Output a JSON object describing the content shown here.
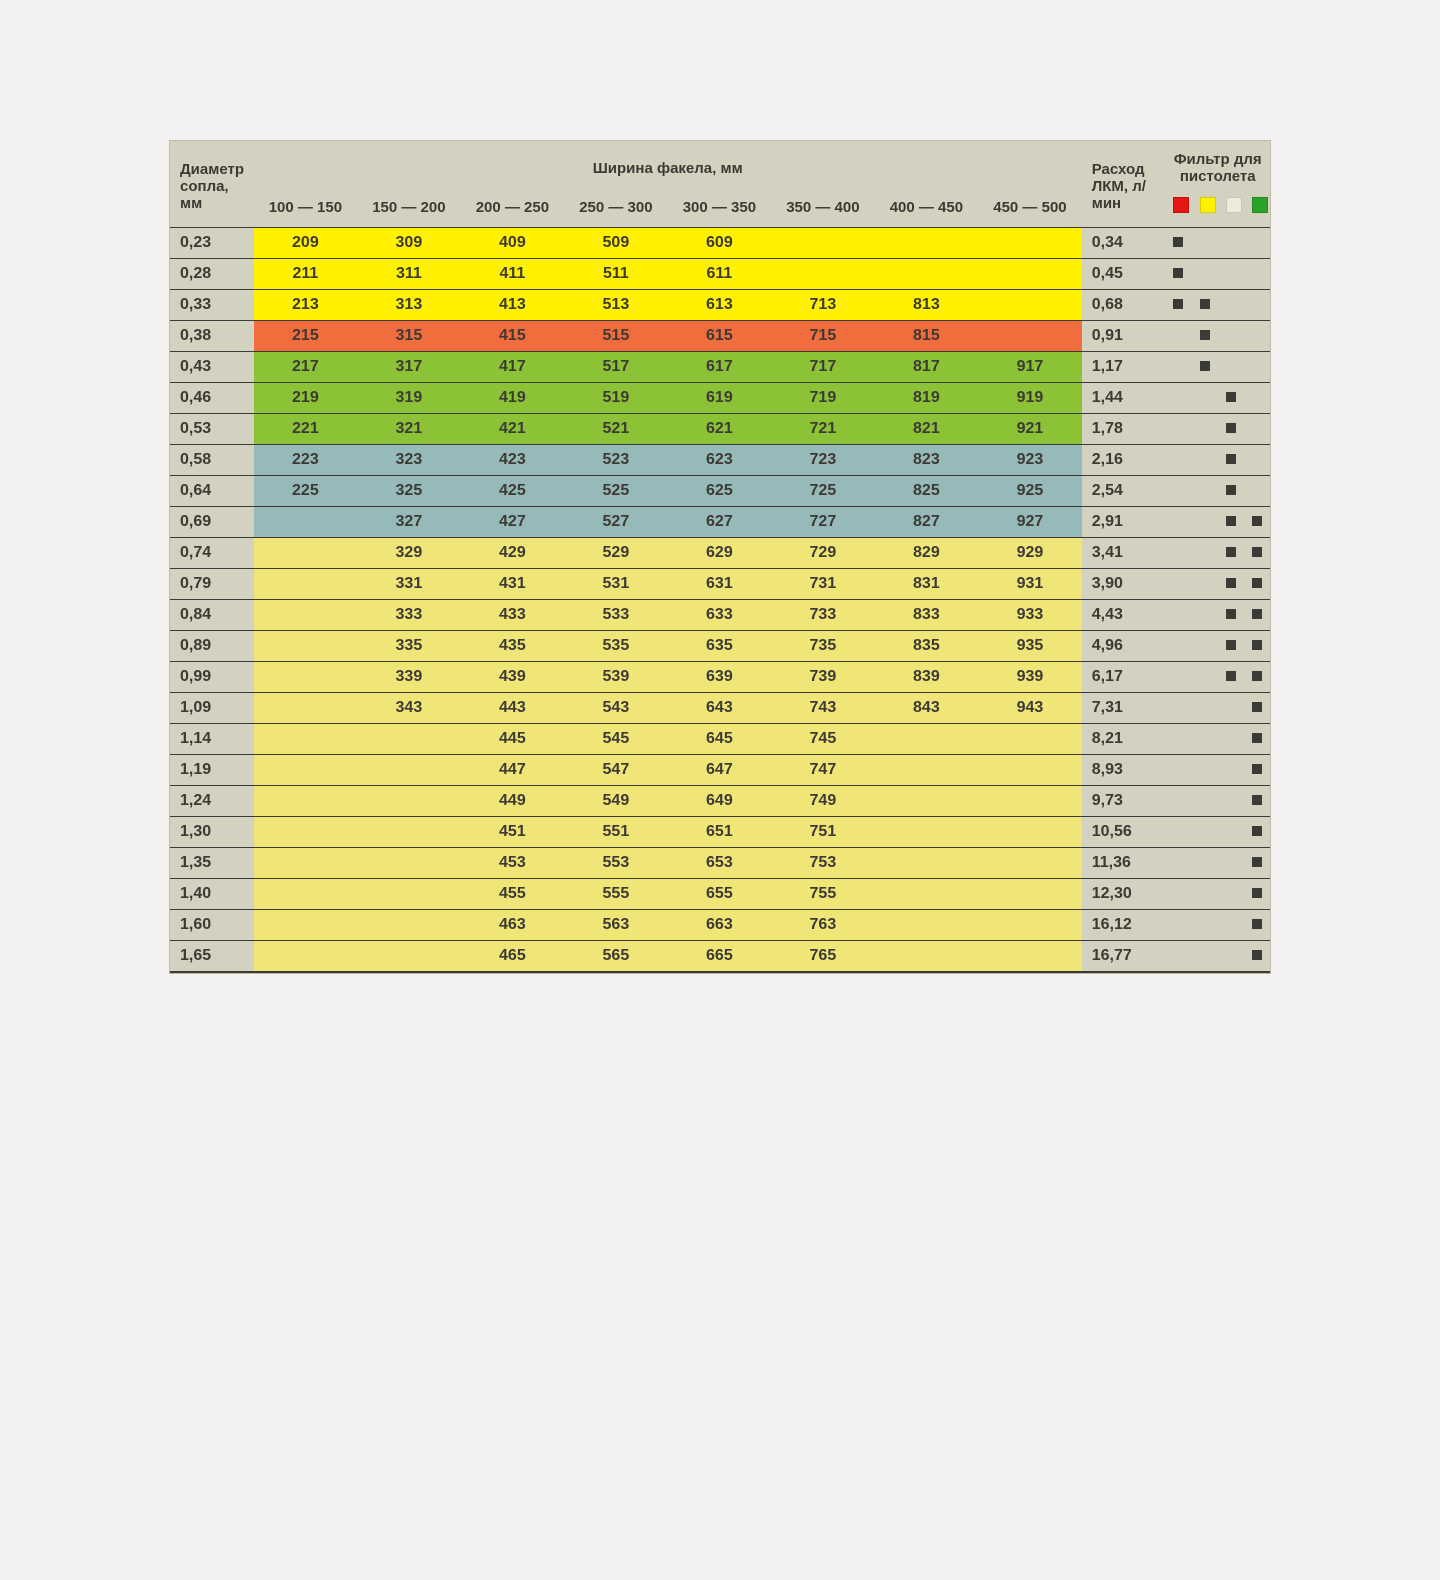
{
  "headers": {
    "diam": "Диаметр сопла, мм",
    "torch": "Ширина факела, мм",
    "flow": "Расход ЛКМ, л/мин",
    "filter": "Фильтр для пистолета",
    "ranges": [
      "100 — 150",
      "150 — 200",
      "200 — 250",
      "250 — 300",
      "300 — 350",
      "350 — 400",
      "400 — 450",
      "450 — 500"
    ]
  },
  "filterColors": [
    "red",
    "yellow",
    "white",
    "green"
  ],
  "colorMap": {
    "neutral": "bg-neu",
    "yellow": "bg-yel",
    "orange": "bg-org",
    "green": "bg-grn",
    "blue": "bg-blu",
    "pale": "bg-pyl"
  },
  "rows": [
    {
      "diam": "0,23",
      "flow": "0,34",
      "color": "yellow",
      "cells": [
        "209",
        "309",
        "409",
        "509",
        "609",
        "",
        "",
        ""
      ],
      "filters": [
        true,
        false,
        false,
        false
      ]
    },
    {
      "diam": "0,28",
      "flow": "0,45",
      "color": "yellow",
      "cells": [
        "211",
        "311",
        "411",
        "511",
        "611",
        "",
        "",
        ""
      ],
      "filters": [
        true,
        false,
        false,
        false
      ]
    },
    {
      "diam": "0,33",
      "flow": "0,68",
      "color": "yellow",
      "cells": [
        "213",
        "313",
        "413",
        "513",
        "613",
        "713",
        "813",
        ""
      ],
      "filters": [
        true,
        true,
        false,
        false
      ]
    },
    {
      "diam": "0,38",
      "flow": "0,91",
      "color": "orange",
      "cells": [
        "215",
        "315",
        "415",
        "515",
        "615",
        "715",
        "815",
        ""
      ],
      "filters": [
        false,
        true,
        false,
        false
      ]
    },
    {
      "diam": "0,43",
      "flow": "1,17",
      "color": "green",
      "cells": [
        "217",
        "317",
        "417",
        "517",
        "617",
        "717",
        "817",
        "917"
      ],
      "filters": [
        false,
        true,
        false,
        false
      ]
    },
    {
      "diam": "0,46",
      "flow": "1,44",
      "color": "green",
      "cells": [
        "219",
        "319",
        "419",
        "519",
        "619",
        "719",
        "819",
        "919"
      ],
      "filters": [
        false,
        false,
        true,
        false
      ]
    },
    {
      "diam": "0,53",
      "flow": "1,78",
      "color": "green",
      "cells": [
        "221",
        "321",
        "421",
        "521",
        "621",
        "721",
        "821",
        "921"
      ],
      "filters": [
        false,
        false,
        true,
        false
      ]
    },
    {
      "diam": "0,58",
      "flow": "2,16",
      "color": "blue",
      "cells": [
        "223",
        "323",
        "423",
        "523",
        "623",
        "723",
        "823",
        "923"
      ],
      "filters": [
        false,
        false,
        true,
        false
      ]
    },
    {
      "diam": "0,64",
      "flow": "2,54",
      "color": "blue",
      "cells": [
        "225",
        "325",
        "425",
        "525",
        "625",
        "725",
        "825",
        "925"
      ],
      "filters": [
        false,
        false,
        true,
        false
      ]
    },
    {
      "diam": "0,69",
      "flow": "2,91",
      "color": "blue",
      "cells": [
        "",
        "327",
        "427",
        "527",
        "627",
        "727",
        "827",
        "927"
      ],
      "filters": [
        false,
        false,
        true,
        true
      ]
    },
    {
      "diam": "0,74",
      "flow": "3,41",
      "color": "pale",
      "cells": [
        "",
        "329",
        "429",
        "529",
        "629",
        "729",
        "829",
        "929"
      ],
      "filters": [
        false,
        false,
        true,
        true
      ]
    },
    {
      "diam": "0,79",
      "flow": "3,90",
      "color": "pale",
      "cells": [
        "",
        "331",
        "431",
        "531",
        "631",
        "731",
        "831",
        "931"
      ],
      "filters": [
        false,
        false,
        true,
        true
      ]
    },
    {
      "diam": "0,84",
      "flow": "4,43",
      "color": "pale",
      "cells": [
        "",
        "333",
        "433",
        "533",
        "633",
        "733",
        "833",
        "933"
      ],
      "filters": [
        false,
        false,
        true,
        true
      ]
    },
    {
      "diam": "0,89",
      "flow": "4,96",
      "color": "pale",
      "cells": [
        "",
        "335",
        "435",
        "535",
        "635",
        "735",
        "835",
        "935"
      ],
      "filters": [
        false,
        false,
        true,
        true
      ]
    },
    {
      "diam": "0,99",
      "flow": "6,17",
      "color": "pale",
      "cells": [
        "",
        "339",
        "439",
        "539",
        "639",
        "739",
        "839",
        "939"
      ],
      "filters": [
        false,
        false,
        true,
        true
      ]
    },
    {
      "diam": "1,09",
      "flow": "7,31",
      "color": "pale",
      "cells": [
        "",
        "343",
        "443",
        "543",
        "643",
        "743",
        "843",
        "943"
      ],
      "filters": [
        false,
        false,
        false,
        true
      ]
    },
    {
      "diam": "1,14",
      "flow": "8,21",
      "color": "pale",
      "cells": [
        "",
        "",
        "445",
        "545",
        "645",
        "745",
        "",
        ""
      ],
      "filters": [
        false,
        false,
        false,
        true
      ]
    },
    {
      "diam": "1,19",
      "flow": "8,93",
      "color": "pale",
      "cells": [
        "",
        "",
        "447",
        "547",
        "647",
        "747",
        "",
        ""
      ],
      "filters": [
        false,
        false,
        false,
        true
      ]
    },
    {
      "diam": "1,24",
      "flow": "9,73",
      "color": "pale",
      "cells": [
        "",
        "",
        "449",
        "549",
        "649",
        "749",
        "",
        ""
      ],
      "filters": [
        false,
        false,
        false,
        true
      ]
    },
    {
      "diam": "1,30",
      "flow": "10,56",
      "color": "pale",
      "cells": [
        "",
        "",
        "451",
        "551",
        "651",
        "751",
        "",
        ""
      ],
      "filters": [
        false,
        false,
        false,
        true
      ]
    },
    {
      "diam": "1,35",
      "flow": "11,36",
      "color": "pale",
      "cells": [
        "",
        "",
        "453",
        "553",
        "653",
        "753",
        "",
        ""
      ],
      "filters": [
        false,
        false,
        false,
        true
      ]
    },
    {
      "diam": "1,40",
      "flow": "12,30",
      "color": "pale",
      "cells": [
        "",
        "",
        "455",
        "555",
        "655",
        "755",
        "",
        ""
      ],
      "filters": [
        false,
        false,
        false,
        true
      ]
    },
    {
      "diam": "1,60",
      "flow": "16,12",
      "color": "pale",
      "cells": [
        "",
        "",
        "463",
        "563",
        "663",
        "763",
        "",
        ""
      ],
      "filters": [
        false,
        false,
        false,
        true
      ]
    },
    {
      "diam": "1,65",
      "flow": "16,77",
      "color": "pale",
      "cells": [
        "",
        "",
        "465",
        "565",
        "665",
        "765",
        "",
        ""
      ],
      "filters": [
        false,
        false,
        false,
        true
      ]
    }
  ]
}
